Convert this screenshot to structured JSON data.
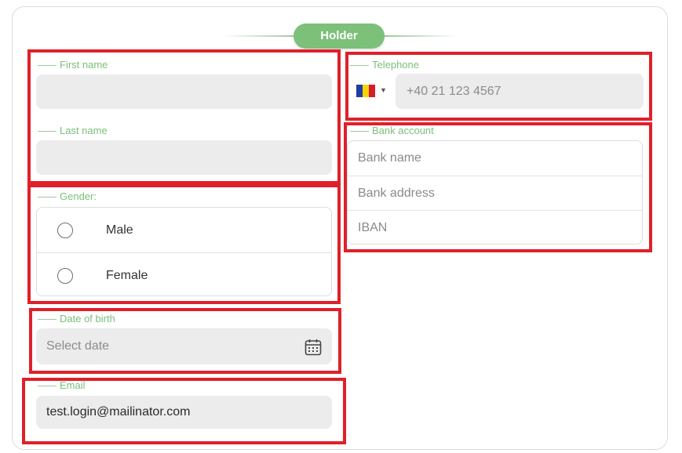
{
  "section": {
    "title": "Holder"
  },
  "first_name": {
    "label": "First name",
    "value": ""
  },
  "last_name": {
    "label": "Last name",
    "value": ""
  },
  "gender": {
    "label": "Gender:",
    "options": [
      "Male",
      "Female"
    ],
    "selected": null
  },
  "date_of_birth": {
    "label": "Date of birth",
    "placeholder": "Select date"
  },
  "email": {
    "label": "Email",
    "value": "test.login@mailinator.com"
  },
  "telephone": {
    "label": "Telephone",
    "country_flag": "romania-flag-icon",
    "placeholder": "+40 21 123 4567"
  },
  "bank_account": {
    "label": "Bank account",
    "fields": [
      "Bank name",
      "Bank address",
      "IBAN"
    ]
  },
  "colors": {
    "accent_green": "#7cc07a",
    "highlight_red": "#e02029",
    "field_bg": "#ececec"
  }
}
